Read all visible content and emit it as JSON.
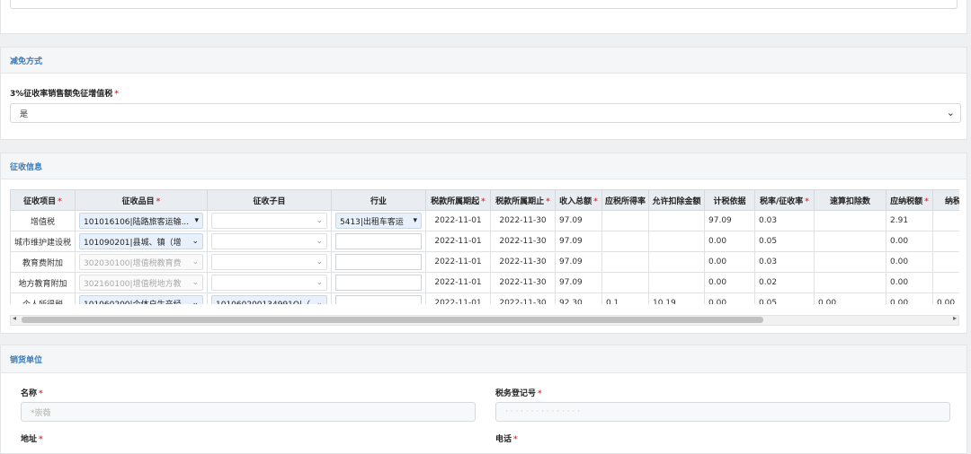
{
  "reduction": {
    "header": "减免方式",
    "field_label": "3%征收率销售额免征增值税",
    "field_value": "是"
  },
  "collection": {
    "header": "征收信息",
    "columns": [
      "征收项目",
      "征收品目",
      "征收子目",
      "行业",
      "税款所属期起",
      "税款所属期止",
      "收入总额",
      "应税所得率",
      "允许扣除金额",
      "计税依据",
      "税率/征收率",
      "速算扣除数",
      "应纳税额",
      "纳税期"
    ],
    "required_cols": [
      0,
      1,
      4,
      5,
      6,
      10,
      12
    ],
    "rows": [
      {
        "item": "增值税",
        "category": "101016106|陆路旅客运输...",
        "sub": "",
        "industry": "5413|出租车客运",
        "start": "2022-11-01",
        "end": "2022-11-30",
        "income": "97.09",
        "rate_taxable": "",
        "deduct": "",
        "basis": "97.09",
        "rate": "0.03",
        "quick": "",
        "tax": "2.91",
        "period": ""
      },
      {
        "item": "城市维护建设税",
        "category": "101090201|县城、镇（增",
        "sub": "",
        "industry": "",
        "start": "2022-11-01",
        "end": "2022-11-30",
        "income": "97.09",
        "rate_taxable": "",
        "deduct": "",
        "basis": "0.00",
        "rate": "0.05",
        "quick": "",
        "tax": "0.00",
        "period": ""
      },
      {
        "item": "教育费附加",
        "category": "302030100|增值税教育费",
        "sub": "",
        "industry": "",
        "start": "2022-11-01",
        "end": "2022-11-30",
        "income": "97.09",
        "rate_taxable": "",
        "deduct": "",
        "basis": "0.00",
        "rate": "0.03",
        "quick": "",
        "tax": "0.00",
        "period": ""
      },
      {
        "item": "地方教育附加",
        "category": "302160100|增值税地方教",
        "sub": "",
        "industry": "",
        "start": "2022-11-01",
        "end": "2022-11-30",
        "income": "97.09",
        "rate_taxable": "",
        "deduct": "",
        "basis": "0.00",
        "rate": "0.02",
        "quick": "",
        "tax": "0.00",
        "period": ""
      },
      {
        "item": "个人所得税",
        "category": "101060200|个体户生产经",
        "sub": "101060200134991O|（",
        "industry": "",
        "start": "2022-11-01",
        "end": "2022-11-30",
        "income": "92.30",
        "rate_taxable": "0.1",
        "deduct": "10.19",
        "basis": "0.00",
        "rate": "0.05",
        "quick": "0.00",
        "tax": "0.00",
        "period": "0.00"
      }
    ]
  },
  "seller": {
    "header": "销货单位",
    "name_label": "名称",
    "name_placeholder": "*崇薇",
    "taxid_label": "税务登记号",
    "taxid_value": "· · · · · · · · · · · · · · ·",
    "address_label": "地址",
    "phone_label": "电话"
  },
  "colors": {
    "accent": "#3a7ab8",
    "required": "#e03a3a",
    "selected_cell": "#e8f0fb"
  }
}
